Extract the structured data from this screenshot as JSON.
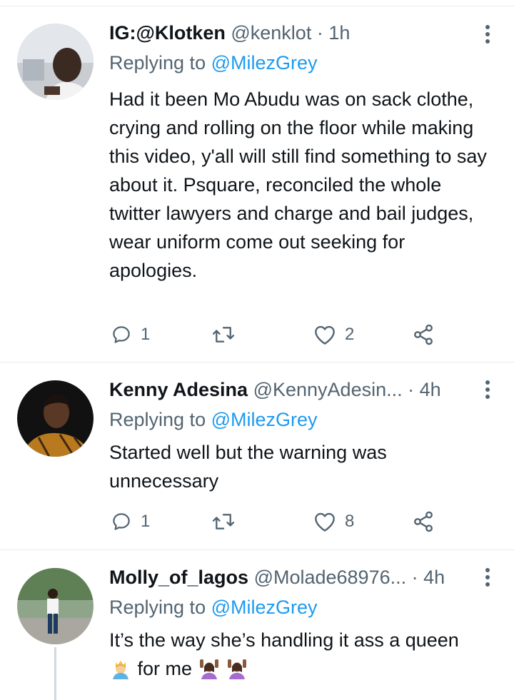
{
  "tweets": [
    {
      "name": "IG:@Klotken",
      "handle": "@kenklot",
      "time": "1h",
      "replying_prefix": "Replying to",
      "replying_to": "@MilezGrey",
      "text": "Had it been Mo Abudu was on sack clothe, crying and rolling on the floor while making this video, y'all will still find something to say about it. Psquare, reconciled the whole twitter lawyers and charge and bail judges, wear uniform come out seeking for apologies.",
      "replies": "1",
      "retweets": "",
      "likes": "2"
    },
    {
      "name": "Kenny Adesina",
      "handle": "@KennyAdesin...",
      "time": "4h",
      "replying_prefix": "Replying to",
      "replying_to": "@MilezGrey",
      "text": "Started well but the warning was unnecessary",
      "replies": "1",
      "retweets": "",
      "likes": "8"
    },
    {
      "name": "Molly_of_lagos",
      "handle": "@Molade68976...",
      "time": "4h",
      "replying_prefix": "Replying to",
      "replying_to": "@MilezGrey",
      "text_part1": "It’s the way she’s handling it ass a queen",
      "text_part2": "for me",
      "emoji1": "princess-emoji",
      "emoji2": "woman-raising-hands-emoji"
    }
  ],
  "colors": {
    "text": "#0f1419",
    "secondary": "#536471",
    "link": "#1d9bf0",
    "divider": "#e6ecf0"
  },
  "separator": "·"
}
